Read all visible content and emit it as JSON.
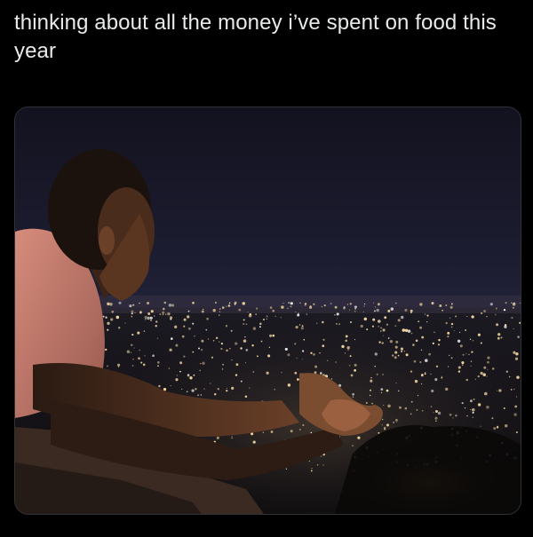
{
  "post": {
    "caption": "thinking about all the money i’ve spent on food this year"
  },
  "media": {
    "kind": "photo",
    "sky_color": "#1a1a30",
    "city_light_color": "#f3d7a0",
    "shirt_color": "#c97f70",
    "skin_color": "#3a2418"
  }
}
